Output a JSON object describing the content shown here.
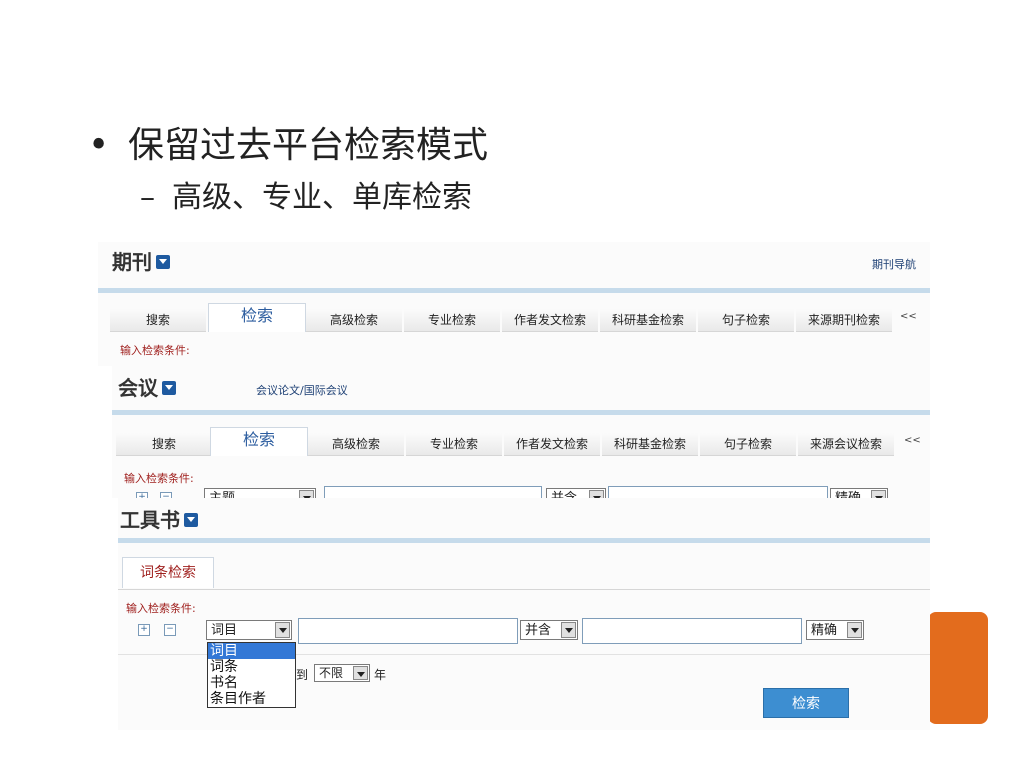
{
  "slide": {
    "bullet": "保留过去平台检索模式",
    "bullet_marker": "•",
    "sub_bullet": "高级、专业、单库检索",
    "sub_marker": "–"
  },
  "journal": {
    "title": "期刊",
    "nav_link": "期刊导航",
    "tabs": [
      "搜索",
      "检索",
      "高级检索",
      "专业检索",
      "作者发文检索",
      "科研基金检索",
      "句子检索",
      "来源期刊检索"
    ],
    "more": "<<",
    "condition_label": "输入检索条件:"
  },
  "conference": {
    "title": "会议",
    "sub_link": "会议论文/国际会议",
    "tabs": [
      "搜索",
      "检索",
      "高级检索",
      "专业检索",
      "作者发文检索",
      "科研基金检索",
      "句子检索",
      "来源会议检索"
    ],
    "more": "<<",
    "condition_label": "输入检索条件:",
    "field_select": "主题",
    "logic_select": "并含",
    "match_select": "精确"
  },
  "reference": {
    "title": "工具书",
    "tab": "词条检索",
    "condition_label": "输入检索条件:",
    "field_select": "词目",
    "field_options": [
      "词目",
      "词条",
      "书名",
      "条目作者"
    ],
    "logic_select": "并含",
    "match_select": "精确",
    "year_to": "到",
    "year_select": "不限",
    "year_unit": "年",
    "search_button": "检索"
  },
  "colors": {
    "accent": "#e36c1d",
    "tab_active_text": "#2c5d9f",
    "button": "#3d8ed1",
    "label_red": "#a0211f"
  }
}
